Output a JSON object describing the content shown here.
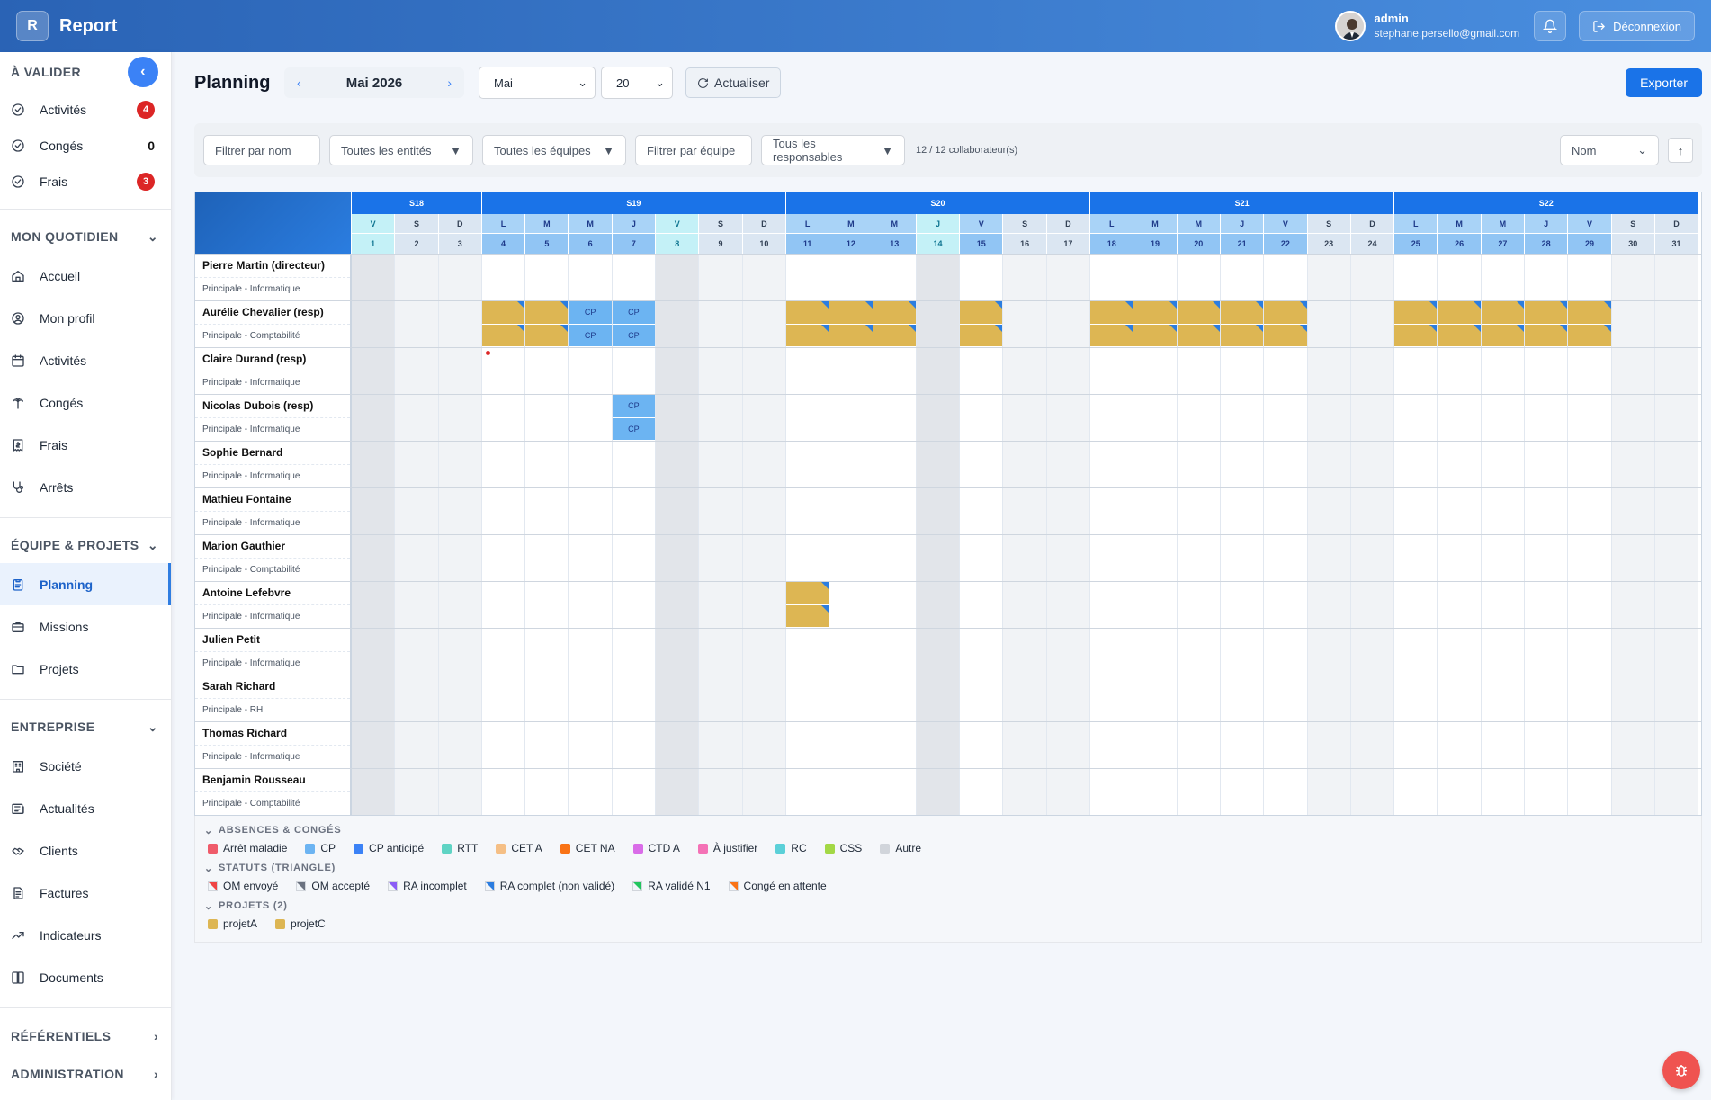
{
  "app": {
    "logo_letter": "R",
    "title": "Report"
  },
  "user": {
    "name": "admin",
    "email": "stephane.persello@gmail.com",
    "logout_label": "Déconnexion"
  },
  "sidebar": {
    "sections": [
      {
        "title": "À VALIDER",
        "items": [
          {
            "label": "Activités",
            "icon": "check-circle-icon",
            "badge": "4",
            "badge_type": "red"
          },
          {
            "label": "Congés",
            "icon": "check-circle-icon",
            "badge": "0",
            "badge_type": "plain"
          },
          {
            "label": "Frais",
            "icon": "check-circle-icon",
            "badge": "3",
            "badge_type": "red"
          }
        ]
      },
      {
        "title": "MON QUOTIDIEN",
        "items": [
          {
            "label": "Accueil",
            "icon": "home-icon"
          },
          {
            "label": "Mon profil",
            "icon": "user-circle-icon"
          },
          {
            "label": "Activités",
            "icon": "calendar-icon"
          },
          {
            "label": "Congés",
            "icon": "palm-tree-icon"
          },
          {
            "label": "Frais",
            "icon": "receipt-icon"
          },
          {
            "label": "Arrêts",
            "icon": "stethoscope-icon"
          }
        ]
      },
      {
        "title": "ÉQUIPE & PROJETS",
        "items": [
          {
            "label": "Planning",
            "icon": "clipboard-icon",
            "active": true
          },
          {
            "label": "Missions",
            "icon": "briefcase-icon"
          },
          {
            "label": "Projets",
            "icon": "folder-icon"
          }
        ]
      },
      {
        "title": "ENTREPRISE",
        "items": [
          {
            "label": "Société",
            "icon": "building-icon"
          },
          {
            "label": "Actualités",
            "icon": "newspaper-icon"
          },
          {
            "label": "Clients",
            "icon": "handshake-icon"
          },
          {
            "label": "Factures",
            "icon": "invoice-icon"
          },
          {
            "label": "Indicateurs",
            "icon": "trending-up-icon"
          },
          {
            "label": "Documents",
            "icon": "book-icon"
          }
        ]
      }
    ],
    "footer_sections": [
      "RÉFÉRENTIELS",
      "ADMINISTRATION"
    ]
  },
  "header": {
    "title": "Planning",
    "month_label": "Mai 2026",
    "month_select": "Mai",
    "count_select": "20",
    "refresh_label": "Actualiser",
    "export_label": "Exporter"
  },
  "filters": {
    "name_placeholder": "Filtrer par nom",
    "entities": "Toutes les entités",
    "teams": "Toutes les équipes",
    "team_placeholder": "Filtrer par équipe",
    "managers": "Tous les responsables",
    "count": "12 / 12 collaborateur(s)",
    "sort": "Nom",
    "sort_dir": "↑"
  },
  "calendar": {
    "weeks": [
      {
        "label": "S18",
        "span": 3
      },
      {
        "label": "S19",
        "span": 7
      },
      {
        "label": "S20",
        "span": 7
      },
      {
        "label": "S21",
        "span": 7
      },
      {
        "label": "S22",
        "span": 7
      }
    ],
    "day_letters": [
      "V",
      "S",
      "D",
      "L",
      "M",
      "M",
      "J",
      "V",
      "S",
      "D",
      "L",
      "M",
      "M",
      "J",
      "V",
      "S",
      "D",
      "L",
      "M",
      "M",
      "J",
      "V",
      "S",
      "D",
      "L",
      "M",
      "M",
      "J",
      "V",
      "S",
      "D"
    ],
    "weekend_days": [
      2,
      3,
      9,
      10,
      16,
      17,
      23,
      24,
      30,
      31
    ],
    "holiday_days": [
      1,
      8,
      14
    ]
  },
  "people": [
    {
      "name": "Pierre Martin (directeur)",
      "sub": "Principale - Informatique",
      "cells": {}
    },
    {
      "name": "Aurélie Chevalier (resp)",
      "sub": "Principale - Comptabilité",
      "cells": {
        "4": "proj",
        "5": "proj",
        "6": "cp",
        "7": "cp",
        "11": "proj",
        "12": "proj",
        "13": "proj",
        "15": "proj",
        "18": "proj",
        "19": "proj",
        "20": "proj",
        "21": "proj",
        "22": "proj",
        "25": "proj",
        "26": "proj",
        "27": "proj",
        "28": "proj",
        "29": "proj"
      }
    },
    {
      "name": "Claire Durand (resp)",
      "sub": "Principale - Informatique",
      "cells": {},
      "dot_day": 4
    },
    {
      "name": "Nicolas Dubois (resp)",
      "sub": "Principale - Informatique",
      "cells": {
        "7": "cp"
      }
    },
    {
      "name": "Sophie Bernard",
      "sub": "Principale - Informatique",
      "cells": {}
    },
    {
      "name": "Mathieu Fontaine",
      "sub": "Principale - Informatique",
      "cells": {}
    },
    {
      "name": "Marion Gauthier",
      "sub": "Principale - Comptabilité",
      "cells": {}
    },
    {
      "name": "Antoine Lefebvre",
      "sub": "Principale - Informatique",
      "cells": {
        "11": "proj"
      }
    },
    {
      "name": "Julien Petit",
      "sub": "Principale - Informatique",
      "cells": {}
    },
    {
      "name": "Sarah Richard",
      "sub": "Principale - RH",
      "cells": {}
    },
    {
      "name": "Thomas Richard",
      "sub": "Principale - Informatique",
      "cells": {}
    },
    {
      "name": "Benjamin Rousseau",
      "sub": "Principale - Comptabilité",
      "cells": {}
    }
  ],
  "cell_text": {
    "cp": "CP"
  },
  "legend": {
    "absences_title": "ABSENCES & CONGÉS",
    "absences": [
      {
        "label": "Arrêt maladie",
        "color": "#ef5b6a"
      },
      {
        "label": "CP",
        "color": "#6cb4f2"
      },
      {
        "label": "CP anticipé",
        "color": "#3b82f6"
      },
      {
        "label": "RTT",
        "color": "#5fd4c4"
      },
      {
        "label": "CET A",
        "color": "#f5bf85"
      },
      {
        "label": "CET NA",
        "color": "#f97316"
      },
      {
        "label": "CTD A",
        "color": "#d96ce8"
      },
      {
        "label": "À justifier",
        "color": "#f472b6"
      },
      {
        "label": "RC",
        "color": "#5bd0d8"
      },
      {
        "label": "CSS",
        "color": "#a3d845"
      },
      {
        "label": "Autre",
        "color": "#d1d5db"
      }
    ],
    "statuts_title": "STATUTS (TRIANGLE)",
    "statuts": [
      {
        "label": "OM envoyé",
        "color": "#ef4444"
      },
      {
        "label": "OM accepté",
        "color": "#6b7280"
      },
      {
        "label": "RA incomplet",
        "color": "#8b5cf6"
      },
      {
        "label": "RA complet (non validé)",
        "color": "#2b7de0"
      },
      {
        "label": "RA validé N1",
        "color": "#22c55e"
      },
      {
        "label": "Congé en attente",
        "color": "#f97316"
      }
    ],
    "projets_title": "PROJETS (2)",
    "projets": [
      {
        "label": "projetA",
        "color": "#ddb653"
      },
      {
        "label": "projetC",
        "color": "#ddb653"
      }
    ]
  }
}
